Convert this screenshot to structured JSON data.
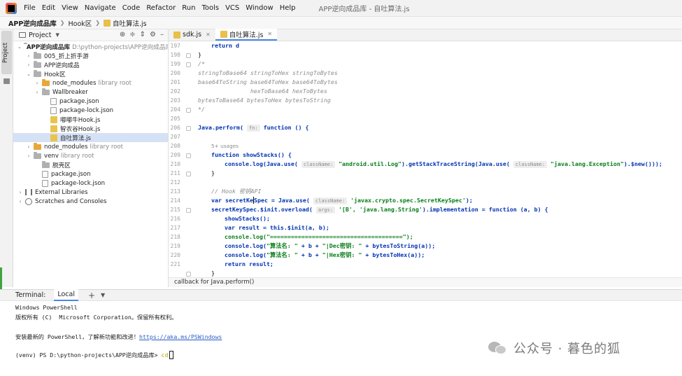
{
  "menu": {
    "items": [
      "File",
      "Edit",
      "View",
      "Navigate",
      "Code",
      "Refactor",
      "Run",
      "Tools",
      "VCS",
      "Window",
      "Help"
    ],
    "window_title": "APP逆向成品库 - 自吐算法.js"
  },
  "navbar": {
    "crumbs": [
      "APP逆向成品库",
      "Hook区",
      "自吐算法.js"
    ]
  },
  "left_strip": {
    "project_tab": "Project"
  },
  "project_panel": {
    "title": "Project"
  },
  "tree": [
    {
      "arrow": "v",
      "icon": "folder",
      "label": "APP逆向成品库",
      "extra": "D:\\python-projects\\APP逆向成品库",
      "bold": true
    },
    {
      "arrow": ">",
      "icon": "folder",
      "label": "005_折上折手游",
      "extra": ""
    },
    {
      "arrow": ">",
      "icon": "folder",
      "label": "APP逆向成品",
      "extra": ""
    },
    {
      "arrow": "v",
      "icon": "folder",
      "label": "Hook区",
      "extra": ""
    },
    {
      "arrow": ">",
      "icon": "folder-orange",
      "label": "node_modules",
      "extra": "library root"
    },
    {
      "arrow": ">",
      "icon": "folder",
      "label": "Wallbreaker",
      "extra": ""
    },
    {
      "arrow": "",
      "icon": "file",
      "label": "package.json",
      "extra": ""
    },
    {
      "arrow": "",
      "icon": "file",
      "label": "package-lock.json",
      "extra": ""
    },
    {
      "arrow": "",
      "icon": "js",
      "label": "嘟嘟牛Hook.js",
      "extra": ""
    },
    {
      "arrow": "",
      "icon": "js",
      "label": "智农谷Hook.js",
      "extra": ""
    },
    {
      "arrow": "",
      "icon": "js",
      "label": "自吐算法.js",
      "extra": "",
      "selected": true
    },
    {
      "arrow": ">",
      "icon": "folder-orange",
      "label": "node_modules",
      "extra": "library root"
    },
    {
      "arrow": ">",
      "icon": "folder",
      "label": "venv",
      "extra": "library root"
    },
    {
      "arrow": "",
      "icon": "folder",
      "label": "脱壳区",
      "extra": ""
    },
    {
      "arrow": "",
      "icon": "file",
      "label": "package.json",
      "extra": ""
    },
    {
      "arrow": "",
      "icon": "file",
      "label": "package-lock.json",
      "extra": ""
    },
    {
      "arrow": ">",
      "icon": "lib",
      "label": "External Libraries",
      "extra": ""
    },
    {
      "arrow": ">",
      "icon": "scratch",
      "label": "Scratches and Consoles",
      "extra": ""
    }
  ],
  "editor_tabs": [
    "sdk.js",
    "自吐算法.js"
  ],
  "gutter": {
    "line_numbers": [
      "197",
      "198",
      "199",
      "200",
      "201",
      "202",
      "203",
      "204",
      "205",
      "206",
      "207",
      "208",
      "209",
      "210",
      "211",
      "212",
      "213",
      "214",
      "215",
      "216",
      "217",
      "218",
      "219",
      "220",
      "221"
    ]
  },
  "code": {
    "l197": "return d",
    "l198": "}",
    "l199": "/*",
    "l200": "stringToBase64 stringToHex stringToBytes",
    "l201": "base64ToString base64ToHex base64ToBytes",
    "l202": "               hexToBase64 hexToBytes",
    "l203": "bytesToBase64 bytesToHex bytesToString",
    "l204": "*/",
    "l206_a": "Java.perform(",
    "l206_hint": "fn:",
    "l206_b": "function () {",
    "usages": "5+ usages",
    "l208": "function showStacks() {",
    "l209_a": "console.log(Java.use(",
    "l209_hint1": "className:",
    "l209_str1": "\"android.util.Log\"",
    "l209_b": ").getStackTraceString(Java.use(",
    "l209_hint2": "className:",
    "l209_str2": "\"java.lang.Exception\"",
    "l209_c": ").$new()));",
    "l210": "}",
    "l212": "// Hook 密钥API",
    "l213_a": "var secretKe",
    "l213_b": "Spec = Java.use(",
    "l213_hint": "className:",
    "l213_str": "'javax.crypto.spec.SecretKeySpec'",
    "l213_c": ");",
    "l214_a": "secretKeySpec.$init.overload(",
    "l214_hint": "args:",
    "l214_str": "'[B', 'java.lang.String'",
    "l214_b": ").implementation = function (a, b) {",
    "l215": "showStacks();",
    "l216": "var result = this.$init(a, b);",
    "l217": "console.log(\"======================================\");",
    "l218_a": "console.log(",
    "l218_str1": "\"算法名: \"",
    "l218_b": " + b + ",
    "l218_str2": "\"|Dec密钥: \"",
    "l218_c": " + bytesToString(a));",
    "l219_a": "console.log(",
    "l219_str1": "\"算法名: \"",
    "l219_b": " + b + ",
    "l219_str2": "\"|Hex密钥: \"",
    "l219_c": " + bytesToHex(a));",
    "l220": "return result;",
    "l221": "}"
  },
  "editor_breadcrumb": "callback for Java.perform()",
  "terminal": {
    "label": "Terminal:",
    "tab": "Local",
    "lines": {
      "l1": "Windows PowerShell",
      "l2": "版权所有 (C)  Microsoft Corporation。保留所有权利。",
      "l3_prefix": "安装最新的 PowerShell，了解新功能和改进！",
      "l3_link": "https://aka.ms/PSWindows",
      "l4_prompt": "(venv) PS D:\\python-projects\\APP逆向成品库> ",
      "l4_cmd": "cd"
    }
  },
  "watermark": {
    "text": "公众号 · 暮色的狐"
  }
}
